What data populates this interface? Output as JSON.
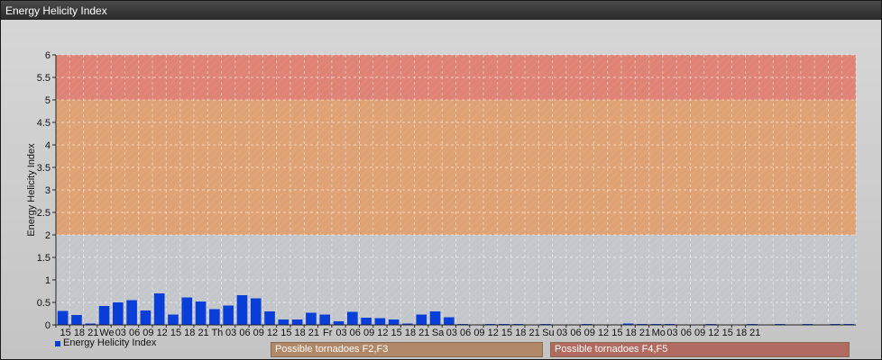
{
  "window": {
    "title": "Energy Helicity Index"
  },
  "chart_data": {
    "type": "bar",
    "title": "",
    "ylabel": "Energy Helicity Index",
    "xlabel": "",
    "ylim": [
      0,
      6
    ],
    "yticks": [
      "0",
      "0.5",
      "1",
      "1.5",
      "2",
      "2.5",
      "3",
      "3.5",
      "4",
      "4.5",
      "5",
      "5.5",
      "6"
    ],
    "categories": [
      "15",
      "18",
      "21",
      "We",
      "03",
      "06",
      "09",
      "12",
      "15",
      "18",
      "21",
      "Th",
      "03",
      "06",
      "09",
      "12",
      "15",
      "18",
      "21",
      "Fr",
      "03",
      "06",
      "09",
      "12",
      "15",
      "18",
      "21",
      "Sa",
      "03",
      "06",
      "09",
      "12",
      "15",
      "18",
      "21",
      "Su",
      "03",
      "06",
      "09",
      "12",
      "15",
      "18",
      "21",
      "Mo",
      "03",
      "06",
      "09",
      "12",
      "15",
      "18",
      "21"
    ],
    "series": [
      {
        "name": "Energy Helicity Index",
        "color": "#0a3ed8",
        "values": [
          0.31,
          0.22,
          0.03,
          0.42,
          0.5,
          0.55,
          0.32,
          0.7,
          0.23,
          0.61,
          0.52,
          0.35,
          0.43,
          0.66,
          0.59,
          0.3,
          0.12,
          0.12,
          0.27,
          0.23,
          0.08,
          0.29,
          0.16,
          0.15,
          0.12,
          0.03,
          0.23,
          0.3,
          0.17,
          0.02,
          0.01,
          0.02,
          0.02,
          0.02,
          0.01,
          0.02,
          0.01,
          0.01,
          0.02,
          0.01,
          0.01,
          0.03,
          0.02,
          0.02,
          0.02,
          0.01,
          0.01,
          0.02,
          0.01,
          0.01,
          0.02,
          0.01,
          0.02,
          0.01,
          0.02,
          0.01,
          0.02,
          0.02
        ]
      }
    ],
    "zones": [
      {
        "from": 2,
        "to": 5,
        "color": "#e0a070",
        "label": "Possible tornadoes F2,F3"
      },
      {
        "from": 5,
        "to": 6,
        "color": "#df8070",
        "label": "Possible tornadoes F4,F5"
      }
    ],
    "grid": true,
    "legend_position": "bottom-left"
  }
}
